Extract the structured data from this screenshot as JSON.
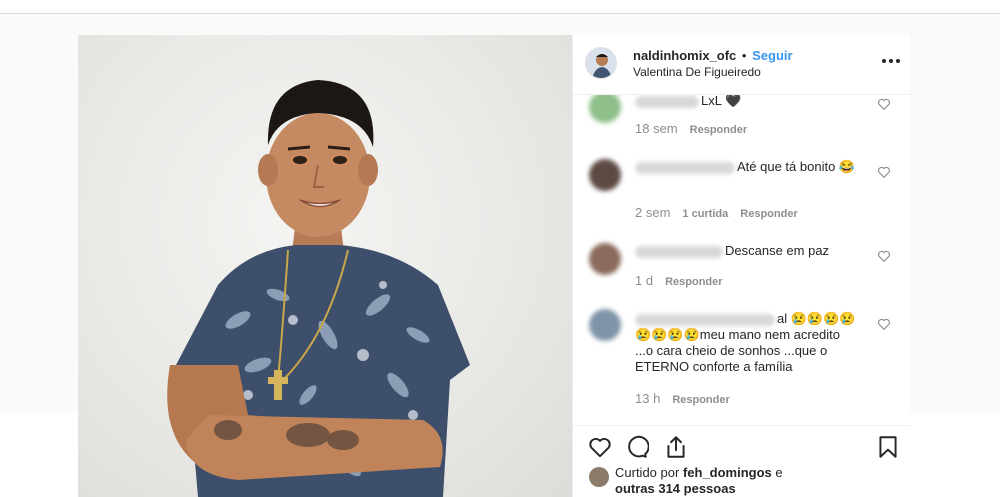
{
  "post": {
    "username": "naldinhomix_ofc",
    "separator": "•",
    "follow_label": "Seguir",
    "location": "Valentina De Figueiredo",
    "more_icon": "more-horizontal-icon"
  },
  "comments": [
    {
      "text": "LxL 🖤",
      "time": "18 sem",
      "likes": "",
      "reply": "Responder"
    },
    {
      "text": "Até que tá bonito 😂",
      "time": "2 sem",
      "likes": "1 curtida",
      "reply": "Responder"
    },
    {
      "text": "Descanse em paz",
      "time": "1 d",
      "likes": "",
      "reply": "Responder"
    },
    {
      "text": "al 😢😢😢😢 😢😢😢😢meu mano nem acredito ...o cara cheio de sonhos ...que o ETERNO conforte a família",
      "time": "13 h",
      "likes": "",
      "reply": "Responder"
    }
  ],
  "actions": {
    "like_icon": "heart-icon",
    "comment_icon": "comment-icon",
    "share_icon": "share-icon",
    "save_icon": "bookmark-icon"
  },
  "liked_by": {
    "prefix": "Curtido por",
    "user": "feh_domingos",
    "conj": "e",
    "others": "outras 314 pessoas"
  },
  "colors": {
    "accent": "#3897f0",
    "text": "#262626",
    "muted": "#8e8e8e",
    "border": "#efefef"
  }
}
